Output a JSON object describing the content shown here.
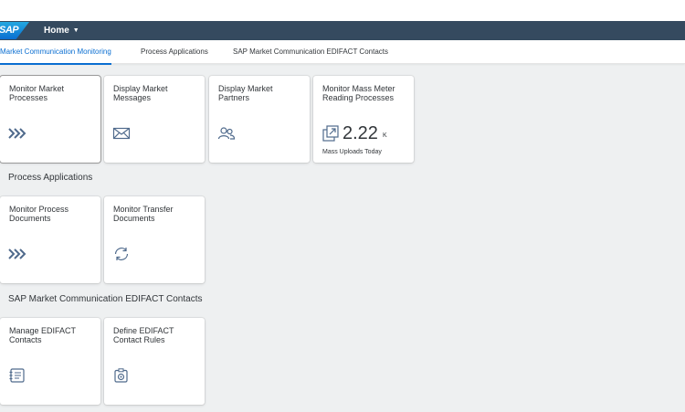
{
  "shell": {
    "logo_text": "SAP",
    "home_label": "Home"
  },
  "anchors": [
    {
      "label": "Market Communication Monitoring",
      "active": true
    },
    {
      "label": "Process Applications",
      "active": false
    },
    {
      "label": "SAP Market Communication EDIFACT Contacts",
      "active": false
    }
  ],
  "sections": [
    {
      "title": "",
      "tiles": [
        {
          "title": "Monitor Market Processes",
          "icon": "process-arrows-icon"
        },
        {
          "title": "Display Market Messages",
          "icon": "envelope-icon"
        },
        {
          "title": "Display Market Partners",
          "icon": "group-icon"
        },
        {
          "title": "Monitor Mass Meter Reading Processes",
          "icon": "upload-launch-icon",
          "kpi_value": "2.22",
          "kpi_unit": "K",
          "footer": "Mass Uploads Today"
        }
      ]
    },
    {
      "title": "Process Applications",
      "tiles": [
        {
          "title": "Monitor Process Documents",
          "icon": "process-arrows-icon"
        },
        {
          "title": "Monitor Transfer Documents",
          "icon": "refresh-icon"
        }
      ]
    },
    {
      "title": "SAP Market Communication EDIFACT Contacts",
      "tiles": [
        {
          "title": "Manage EDIFACT Contacts",
          "icon": "address-book-icon"
        },
        {
          "title": "Define EDIFACT Contact Rules",
          "icon": "contact-rule-icon"
        }
      ]
    }
  ]
}
